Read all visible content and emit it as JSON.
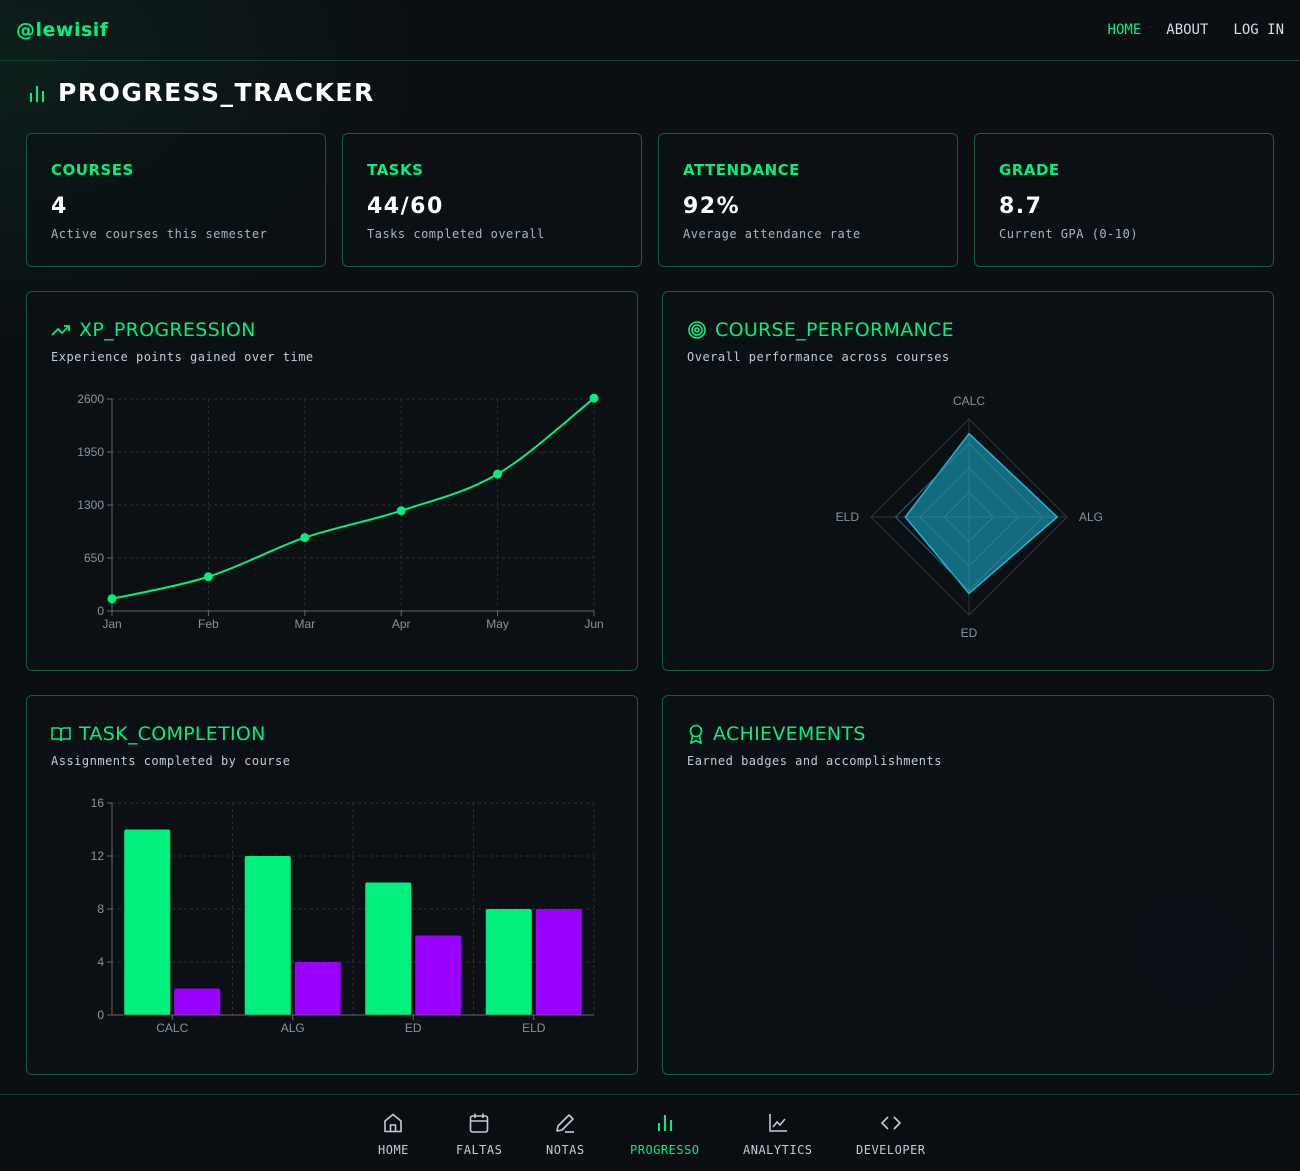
{
  "app": {
    "logo": "@lewisif"
  },
  "topnav": [
    {
      "label": "HOME",
      "active": true
    },
    {
      "label": "ABOUT",
      "active": false
    },
    {
      "label": "LOG IN",
      "active": false
    }
  ],
  "page": {
    "title": "PROGRESS_TRACKER"
  },
  "stats": [
    {
      "label": "COURSES",
      "value": "4",
      "desc": "Active courses this semester"
    },
    {
      "label": "TASKS",
      "value": "44/60",
      "desc": "Tasks completed overall"
    },
    {
      "label": "ATTENDANCE",
      "value": "92%",
      "desc": "Average attendance rate"
    },
    {
      "label": "GRADE",
      "value": "8.7",
      "desc": "Current GPA (0-10)"
    }
  ],
  "panels": {
    "xp": {
      "title": "XP_PROGRESSION",
      "subtitle": "Experience points gained over time",
      "icon": "trending-up-icon"
    },
    "performance": {
      "title": "COURSE_PERFORMANCE",
      "subtitle": "Overall performance across courses",
      "icon": "target-icon"
    },
    "tasks": {
      "title": "TASK_COMPLETION",
      "subtitle": "Assignments completed by course",
      "icon": "book-open-icon"
    },
    "achievements": {
      "title": "ACHIEVEMENTS",
      "subtitle": "Earned badges and accomplishments",
      "icon": "award-icon"
    }
  },
  "colors": {
    "accent": "#00f07e",
    "purple": "#9900ff",
    "radar": "#1fb6d6"
  },
  "chart_data": [
    {
      "type": "line",
      "categories": [
        "Jan",
        "Feb",
        "Mar",
        "Apr",
        "May",
        "Jun"
      ],
      "series": [
        {
          "values": [
            150,
            420,
            900,
            1230,
            1680,
            2610
          ]
        }
      ],
      "yticks": [
        0,
        650,
        1300,
        1950,
        2600
      ],
      "ylim": [
        0,
        2600
      ],
      "grid": true
    },
    {
      "type": "radar",
      "categories": [
        "CALC",
        "ALG",
        "ED",
        "ELD"
      ],
      "values": [
        85,
        90,
        78,
        65
      ],
      "rmax": 100,
      "grid": true
    },
    {
      "type": "bar",
      "categories": [
        "CALC",
        "ALG",
        "ED",
        "ELD"
      ],
      "series": [
        {
          "values": [
            14,
            12,
            10,
            8
          ]
        },
        {
          "values": [
            2,
            4,
            6,
            8
          ]
        }
      ],
      "yticks": [
        0,
        4,
        8,
        12,
        16
      ],
      "ylim": [
        0,
        16
      ],
      "grid": true
    }
  ],
  "bottomnav": [
    {
      "label": "HOME",
      "icon": "home-icon",
      "active": false
    },
    {
      "label": "FALTAS",
      "icon": "calendar-icon",
      "active": false
    },
    {
      "label": "NOTAS",
      "icon": "pen-icon",
      "active": false
    },
    {
      "label": "PROGRESSO",
      "icon": "bar-chart-icon",
      "active": true
    },
    {
      "label": "ANALYTICS",
      "icon": "line-chart-icon",
      "active": false
    },
    {
      "label": "DEVELOPER",
      "icon": "code-icon",
      "active": false
    }
  ]
}
